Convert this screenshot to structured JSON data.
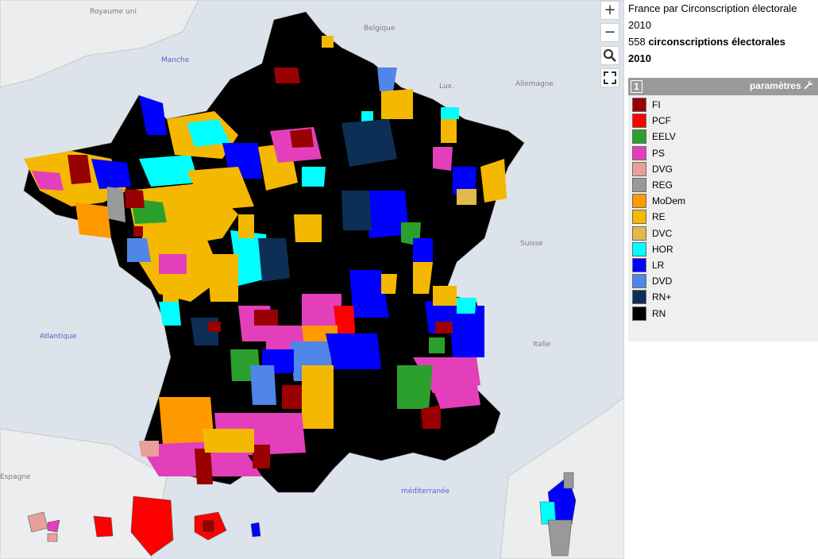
{
  "map": {
    "zoom_in_label": "+",
    "zoom_out_label": "−",
    "search_icon": "search-icon",
    "fullscreen_icon": "fullscreen-icon",
    "labels": {
      "royaume_uni": "Royaume uni",
      "belgique": "Belgique",
      "lux": "Lux.",
      "allemagne": "Allemagne",
      "suisse": "Suisse",
      "italie": "Italie",
      "espagne": "Espagne",
      "manche": "Manche",
      "atlantique": "Atlantique",
      "mediterranee": "méditerranée"
    }
  },
  "info": {
    "title": "France par Circonscription électorale",
    "year": "2010",
    "count": "558",
    "count_label": "circonscriptions électorales",
    "year_bold": "2010"
  },
  "legend": {
    "number": "1",
    "params_label": "paramètres",
    "params_icon": "wrench-icon",
    "items": [
      {
        "label": "FI",
        "color": "#990000"
      },
      {
        "label": "PCF",
        "color": "#ff0000"
      },
      {
        "label": "EELV",
        "color": "#2ca02c"
      },
      {
        "label": "PS",
        "color": "#e33fbb"
      },
      {
        "label": "DVG",
        "color": "#e8a09a"
      },
      {
        "label": "REG",
        "color": "#999999"
      },
      {
        "label": "MoDem",
        "color": "#ff9900"
      },
      {
        "label": "RE",
        "color": "#f5b800"
      },
      {
        "label": "DVC",
        "color": "#e2b94a"
      },
      {
        "label": "HOR",
        "color": "#00ffff"
      },
      {
        "label": "LR",
        "color": "#0000ff"
      },
      {
        "label": "DVD",
        "color": "#4f86e8"
      },
      {
        "label": "RN+",
        "color": "#0d2f56"
      },
      {
        "label": "RN",
        "color": "#000000"
      }
    ]
  }
}
